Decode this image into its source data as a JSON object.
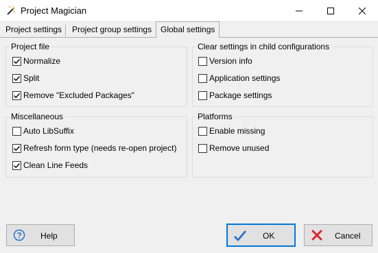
{
  "window": {
    "title": "Project Magician",
    "app_icon": "magic-wand-icon",
    "controls": [
      "minimize-icon",
      "maximize-icon",
      "close-icon"
    ]
  },
  "tabs": [
    {
      "label": "Project settings",
      "active": false
    },
    {
      "label": "Project group settings",
      "active": false
    },
    {
      "label": "Global settings",
      "active": true
    }
  ],
  "groups": {
    "project_file": {
      "title": "Project file",
      "items": [
        {
          "label": "Normalize",
          "checked": true
        },
        {
          "label": "Split",
          "checked": true
        },
        {
          "label": "Remove \"Excluded Packages\"",
          "checked": true
        }
      ]
    },
    "clear_settings": {
      "title": "Clear settings in child configurations",
      "items": [
        {
          "label": "Version info",
          "checked": false
        },
        {
          "label": "Application settings",
          "checked": false
        },
        {
          "label": "Package settings",
          "checked": false
        }
      ]
    },
    "miscellaneous": {
      "title": "Miscellaneous",
      "items": [
        {
          "label": "Auto LibSuffix",
          "checked": false
        },
        {
          "label": "Refresh form type (needs re-open project)",
          "checked": true
        },
        {
          "label": "Clean Line Feeds",
          "checked": true
        }
      ]
    },
    "platforms": {
      "title": "Platforms",
      "items": [
        {
          "label": "Enable missing",
          "checked": false
        },
        {
          "label": "Remove unused",
          "checked": false
        }
      ]
    }
  },
  "buttons": {
    "help": {
      "label": "Help",
      "icon": "help-icon"
    },
    "ok": {
      "label": "OK",
      "icon": "checkmark-icon"
    },
    "cancel": {
      "label": "Cancel",
      "icon": "cross-icon"
    }
  },
  "colors": {
    "accent": "#0078d7",
    "ok_check": "#2a73c9",
    "cancel_cross": "#d9262e"
  }
}
